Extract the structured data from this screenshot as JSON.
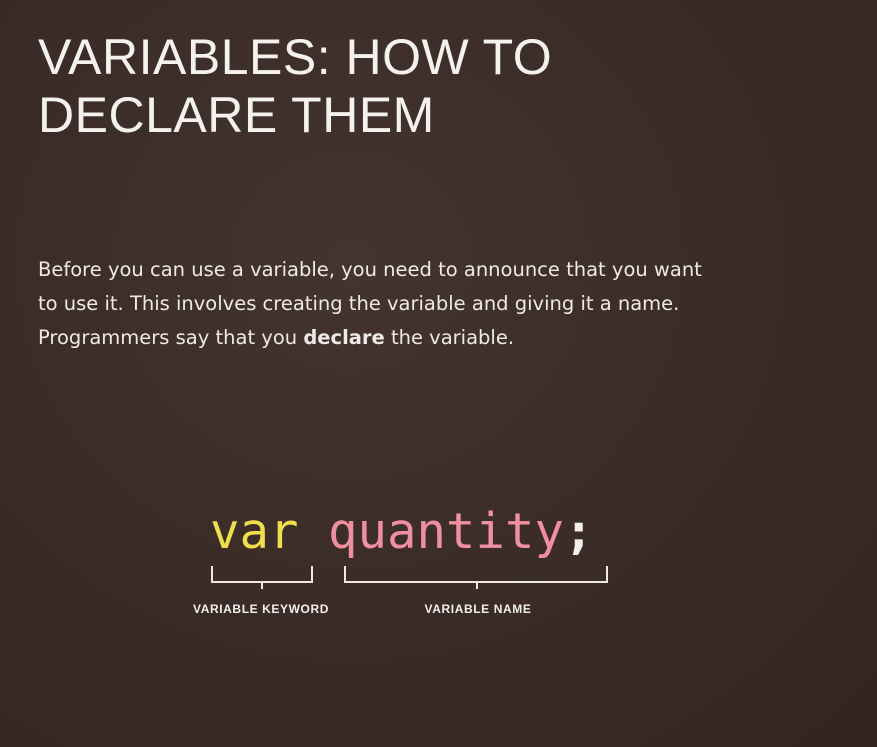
{
  "heading": {
    "line1": "VARIABLES: HOW TO",
    "line2": "DECLARE THEM"
  },
  "intro": {
    "line1": "Before you can use a variable, you need to announce that you want",
    "line2": "to use it. This involves creating the variable and giving it a name.",
    "line3_before": "Programmers say that you ",
    "line3_bold": "declare",
    "line3_after": " the variable."
  },
  "code": {
    "keyword": "var",
    "space": " ",
    "name": "quantity",
    "terminator": ";"
  },
  "labels": {
    "keyword_label": "VARIABLE KEYWORD",
    "name_label": "VARIABLE NAME"
  },
  "colors": {
    "background": "#3a2b27",
    "keyword": "#efdf4d",
    "name": "#f08fa0",
    "text": "#f2efec"
  }
}
